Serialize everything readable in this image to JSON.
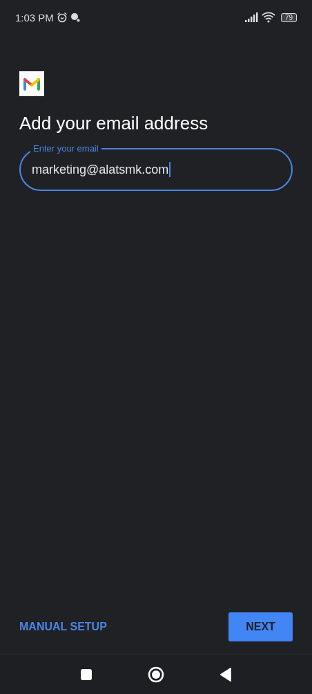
{
  "status_bar": {
    "time": "1:03 PM",
    "battery": "79"
  },
  "title": "Add your email address",
  "email_field": {
    "label": "Enter your email",
    "value": "marketing@alatsmk.com"
  },
  "actions": [
    {
      "label": "MANUAL SETUP",
      "kind": "text"
    },
    {
      "label": "NEXT",
      "kind": "filled"
    }
  ]
}
